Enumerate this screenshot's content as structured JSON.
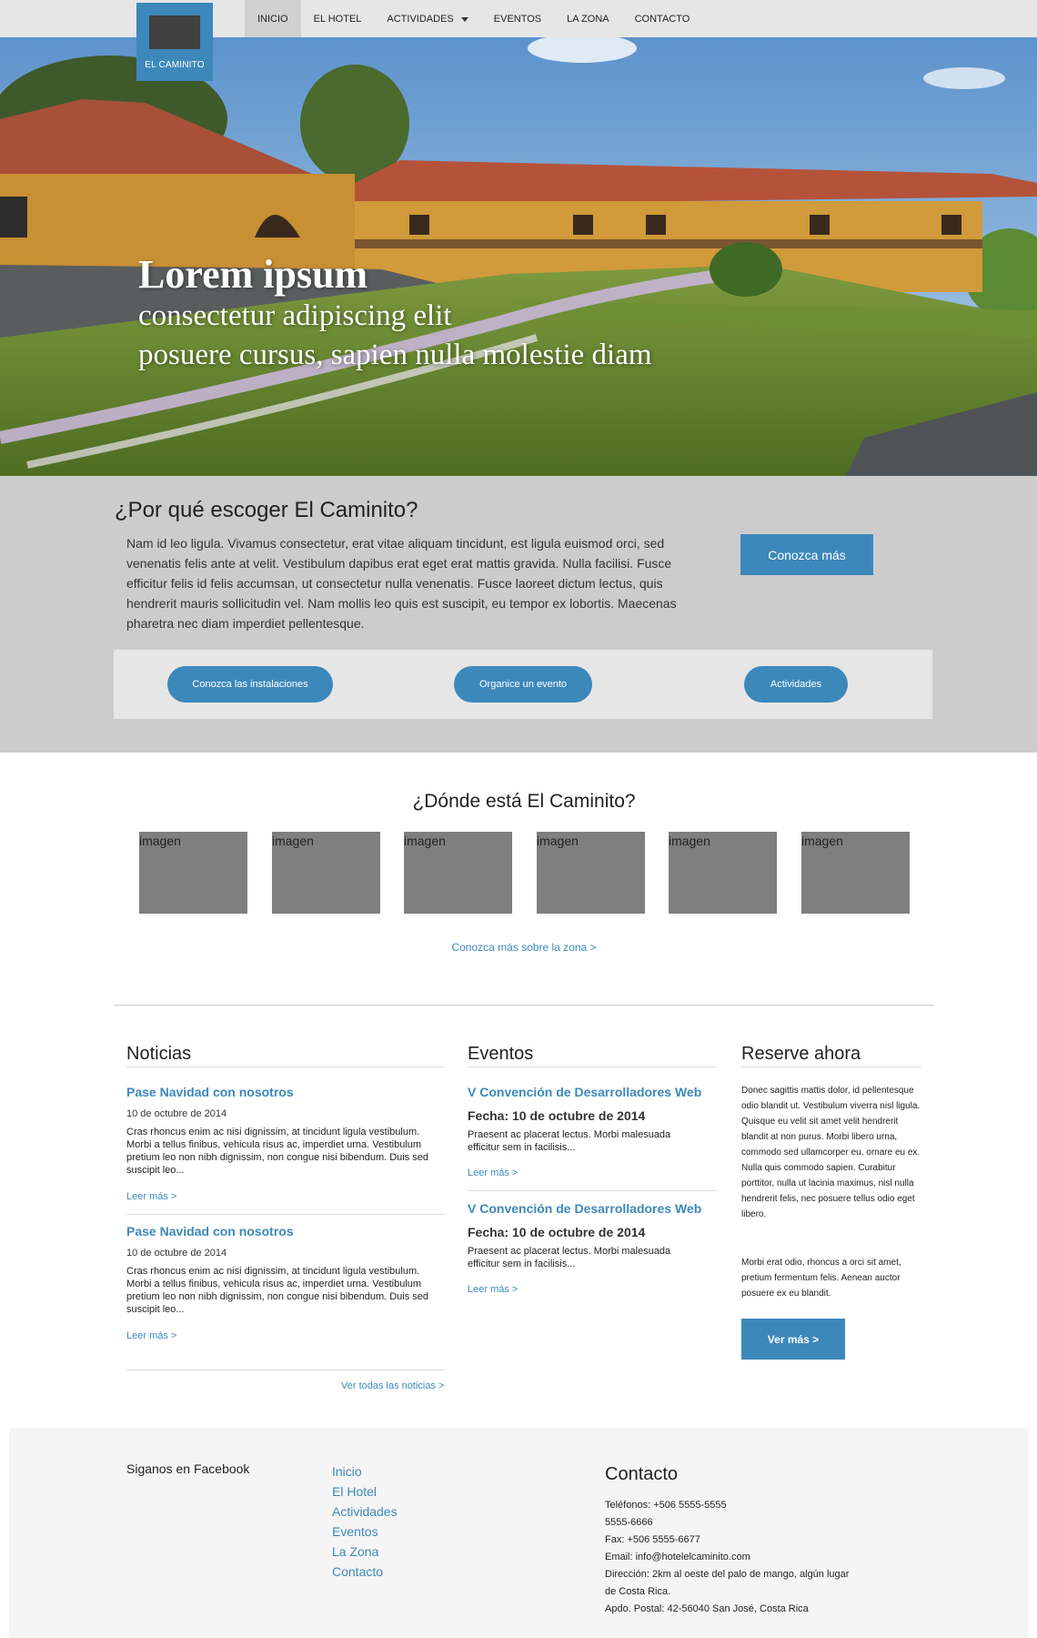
{
  "nav": {
    "logo_text": "EL CAMINITO",
    "items": [
      {
        "label": "INICIO"
      },
      {
        "label": "EL HOTEL"
      },
      {
        "label": "ACTIVIDADES"
      },
      {
        "label": "EVENTOS"
      },
      {
        "label": "LA ZONA"
      },
      {
        "label": "CONTACTO"
      }
    ]
  },
  "hero": {
    "title": "Lorem ipsum",
    "line1": "consectetur adipiscing elit",
    "line2": "posuere cursus, sapien nulla molestie diam"
  },
  "why": {
    "title": "¿Por qué escoger El Caminito?",
    "text": "Nam id leo ligula. Vivamus consectetur, erat vitae aliquam tincidunt, est ligula euismod orci, sed venenatis felis ante at velit. Vestibulum dapibus erat eget erat mattis gravida. Nulla facilisi. Fusce efficitur felis id felis accumsan, ut consectetur nulla venenatis. Fusce laoreet dictum lectus, quis hendrerit mauris sollicitudin vel. Nam mollis leo quis est suscipit, eu tempor ex lobortis. Maecenas pharetra nec diam imperdiet pellentesque.",
    "button": "Conozca más",
    "pills": [
      "Conozca las instalaciones",
      "Organice un evento",
      "Actividades"
    ]
  },
  "where": {
    "title": "¿Dónde está El Caminito?",
    "images": [
      "imagen",
      "imagen",
      "imagen",
      "imagen",
      "imagen",
      "imagen"
    ],
    "link": "Conozca más sobre la zona >"
  },
  "news": {
    "title": "Noticias",
    "posts": [
      {
        "title": "Pase Navidad con nosotros",
        "date": "10 de octubre de 2014",
        "body": "Cras rhoncus enim ac nisi dignissim, at tincidunt ligula vestibulum. Morbi a tellus finibus, vehicula risus ac, imperdiet urna. Vestibulum pretium leo non nibh dignissim, non congue nisi bibendum. Duis sed suscipit leo...",
        "more": "Leer más >"
      },
      {
        "title": "Pase Navidad con nosotros",
        "date": "10 de octubre de 2014",
        "body": "Cras rhoncus enim ac nisi dignissim, at tincidunt ligula vestibulum. Morbi a tellus finibus, vehicula risus ac, imperdiet urna. Vestibulum pretium leo non nibh dignissim, non congue nisi bibendum. Duis sed suscipit leo...",
        "more": "Leer más >"
      }
    ],
    "all_link": "Ver todas las noticias >"
  },
  "events": {
    "title": "Eventos",
    "items": [
      {
        "title": "V Convención de Desarrolladores Web",
        "date": "Fecha: 10 de octubre de 2014",
        "body": "Praesent ac placerat lectus. Morbi malesuada efficitur sem in facilisis...",
        "more": "Leer más >"
      },
      {
        "title": "V Convención de Desarrolladores Web",
        "date": "Fecha: 10 de octubre de 2014",
        "body": "Praesent ac placerat lectus. Morbi malesuada efficitur sem in facilisis...",
        "more": "Leer más >"
      }
    ]
  },
  "reserve": {
    "title": "Reserve ahora",
    "p1": "Donec sagittis mattis dolor, id pellentesque odio blandit ut. Vestibulum viverra nisl ligula. Quisque eu velit sit amet velit hendrerit blandit at non purus. Morbi libero urna, commodo sed ullamcorper eu, ornare eu ex. Nulla quis commodo sapien. Curabitur porttitor, nulla ut lacinia maximus, nisl nulla hendrerit felis, nec posuere tellus odio eget libero.",
    "p2": "Morbi erat odio, rhoncus a orci sit amet, pretium fermentum felis. Aenean auctor posuere ex eu blandit.",
    "button": "Ver más >"
  },
  "footer": {
    "facebook": "Siganos en Facebook",
    "links": [
      "Inicio",
      "El Hotel",
      "Actividades",
      "Eventos",
      "La Zona",
      "Contacto"
    ],
    "contact_title": "Contacto",
    "contact_lines": [
      "Teléfonos: +506 5555-5555",
      "5555-6666",
      "Fax: +506 5555-6677",
      "Email: info@hotelelcaminito.com",
      "Dirección: 2km al oeste del palo de mango, algún lugar de Costa Rica.",
      "Apdo. Postal: 42-56040 San José, Costa Rica"
    ]
  },
  "colors": {
    "accent": "#3d88bb",
    "nav_bg": "#e6e6e6",
    "why_bg": "#cccccc",
    "placeholder": "#7f7f7f"
  }
}
